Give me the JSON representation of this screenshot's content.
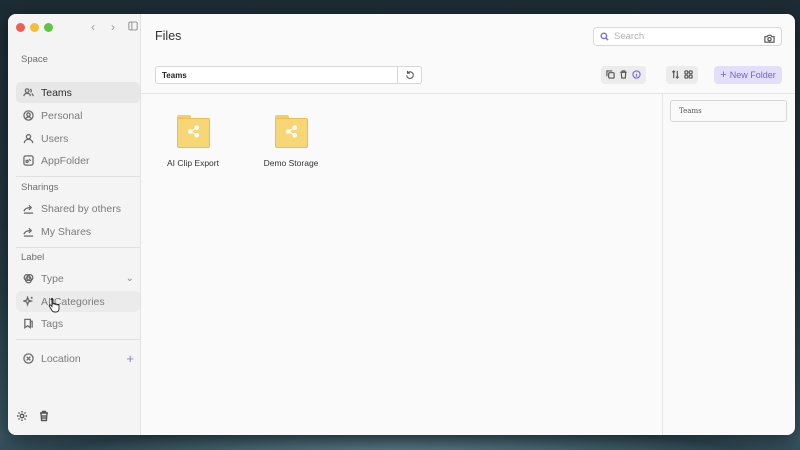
{
  "window": {
    "title": "Files"
  },
  "sidebar": {
    "sections": {
      "space": "Space",
      "sharings": "Sharings",
      "label": "Label"
    },
    "items": [
      {
        "label": "Teams",
        "icon": "users-icon"
      },
      {
        "label": "Personal",
        "icon": "user-circle-icon"
      },
      {
        "label": "Users",
        "icon": "user-icon"
      },
      {
        "label": "AppFolder",
        "icon": "app-folder-icon"
      },
      {
        "label": "Shared by others",
        "icon": "shared-icon"
      },
      {
        "label": "My Shares",
        "icon": "share-icon"
      },
      {
        "label": "Type",
        "icon": "type-icon"
      },
      {
        "label": "AI Categories",
        "icon": "sparkle-icon"
      },
      {
        "label": "Tags",
        "icon": "tag-icon"
      },
      {
        "label": "Location",
        "icon": "location-icon"
      }
    ],
    "active": "Teams"
  },
  "search": {
    "placeholder": "Search"
  },
  "toolbar": {
    "path": "Teams",
    "new_folder_label": "New Folder"
  },
  "files": [
    {
      "name": "AI Clip Export"
    },
    {
      "name": "Demo Storage"
    }
  ],
  "details": {
    "field_value": "Teams"
  },
  "colors": {
    "accent": "#7462d8",
    "accent_bg": "#e3defa",
    "folder": "#f7d676"
  }
}
